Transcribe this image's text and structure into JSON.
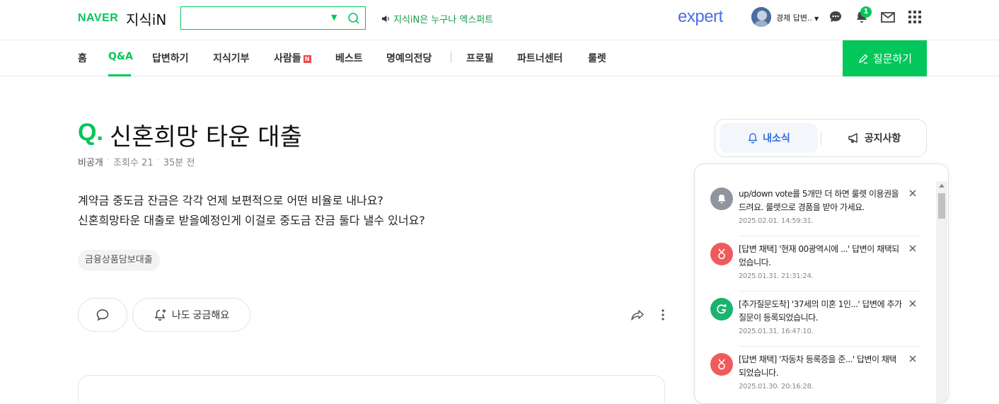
{
  "header": {
    "brand": "NAVER",
    "service": "지식iN",
    "search_placeholder": "",
    "notice": "지식iN은 누구나 엑스퍼트",
    "expert_logo": "expert",
    "username": "경제 답변..",
    "notification_count": "1",
    "icons": [
      "search-icon",
      "speaker-icon",
      "chat-icon",
      "bell-icon",
      "mail-icon",
      "apps-grid-icon"
    ]
  },
  "nav": {
    "items": [
      "홈",
      "Q&A",
      "답변하기",
      "지식기부",
      "사람들",
      "베스트",
      "명예의전당",
      "프로필",
      "파트너센터",
      "룰렛"
    ],
    "active": "Q&A",
    "new_badge": "N",
    "ask_button": "질문하기"
  },
  "question": {
    "mark": "Q.",
    "title": "신혼희망 타운 대출",
    "author": "비공개",
    "views": "조회수 21",
    "time": "35분 전",
    "body_lines": [
      "계약금 중도금 잔금은 각각 언제 보편적으로 어떤 비율로 내나요?",
      "신혼희망타운 대출로 받을예정인게 이걸로 중도금 잔금 둘다 낼수 있너요?"
    ],
    "tag": "금융상품담보대출",
    "curious_button": "나도 궁금해요"
  },
  "side_tabs": {
    "news": "내소식",
    "notice": "공지사항"
  },
  "notifications": [
    {
      "text": "up/down vote를 5개만 더 하면 룰렛 이용권을 드려요. 룰렛으로 경품을 받아 가세요.",
      "time": "2025.02.01. 14:59:31.",
      "icon": "bell-icon",
      "color": "#8e959e"
    },
    {
      "text": "[답변 채택] '현재 00광역시에 ...' 답변이 채택되었습니다.",
      "time": "2025.01.31. 21:31:24.",
      "icon": "medal-icon",
      "color": "#ef5b5b"
    },
    {
      "text": "[추가질문도착] '37세의 미혼 1인...' 답변에 추가질문이 등록되었습니다.",
      "time": "2025.01.31. 16:47:10.",
      "icon": "add-question-icon",
      "color": "#19b46f"
    },
    {
      "text": "[답변 채택] '자동차 등록증을 준...' 답변이 채택되었습니다.",
      "time": "2025.01.30. 20:16:28.",
      "icon": "medal-icon",
      "color": "#ef5b5b"
    }
  ],
  "colors": {
    "brand_green": "#03c75a",
    "expert_blue": "#4f6ee6",
    "tab_blue": "#2d6ce0"
  }
}
